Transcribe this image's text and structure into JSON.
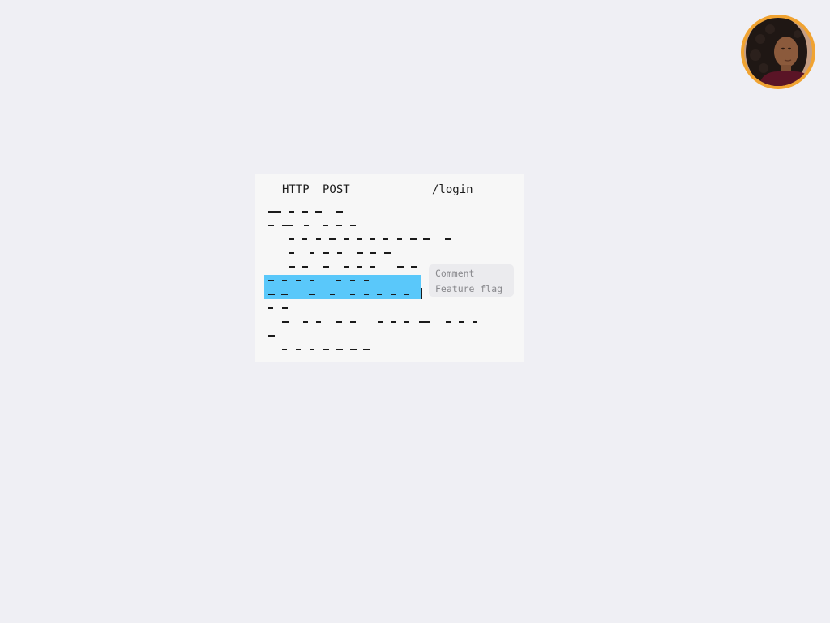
{
  "avatar": {
    "alt": "User avatar",
    "ring_color": "#f0a331"
  },
  "request": {
    "protocol": "HTTP",
    "method": "POST",
    "path": "/login"
  },
  "context_menu": {
    "items": [
      {
        "label": "Comment"
      },
      {
        "label": "Feature flag"
      }
    ]
  },
  "colors": {
    "background": "#efeff4",
    "card": "#f7f7f7",
    "selection": "#5ac8fa",
    "menu_bg": "#ebebee",
    "menu_text": "#8a8a8e"
  }
}
